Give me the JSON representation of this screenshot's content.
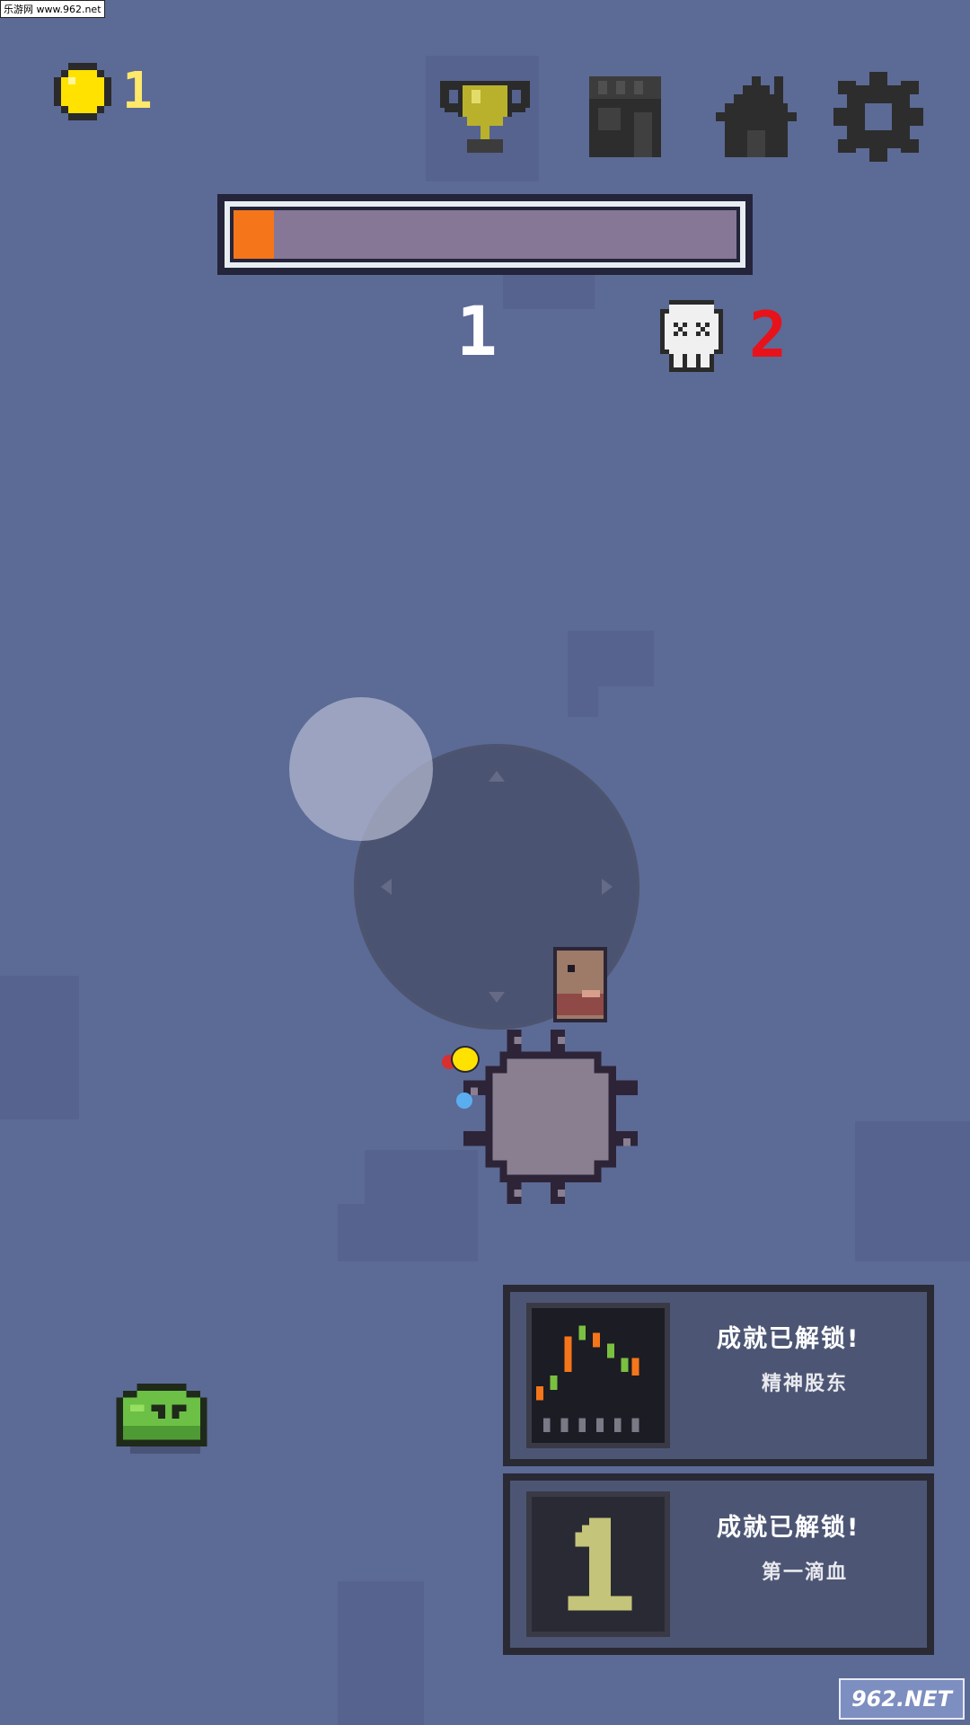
{
  "watermark": "乐游网 www.962.net",
  "hud": {
    "coins": "1",
    "level": "1",
    "deaths": "2",
    "progress_percent": 8
  },
  "menu": {
    "icons": [
      "trophy-icon",
      "shop-icon",
      "home-icon",
      "gear-icon"
    ]
  },
  "achievements": [
    {
      "title": "成就已解锁!",
      "name": "精神股东",
      "icon": "chart-icon"
    },
    {
      "title": "成就已解锁!",
      "name": "第一滴血",
      "icon": "number-one-icon"
    }
  ],
  "corner_logo": "962.NET",
  "colors": {
    "background": "#5c6a96",
    "coin": "#ffe200",
    "progress_fill": "#f5761a",
    "progress_track": "#867796",
    "deaths": "#e8121a",
    "slime": "#6cc046"
  }
}
